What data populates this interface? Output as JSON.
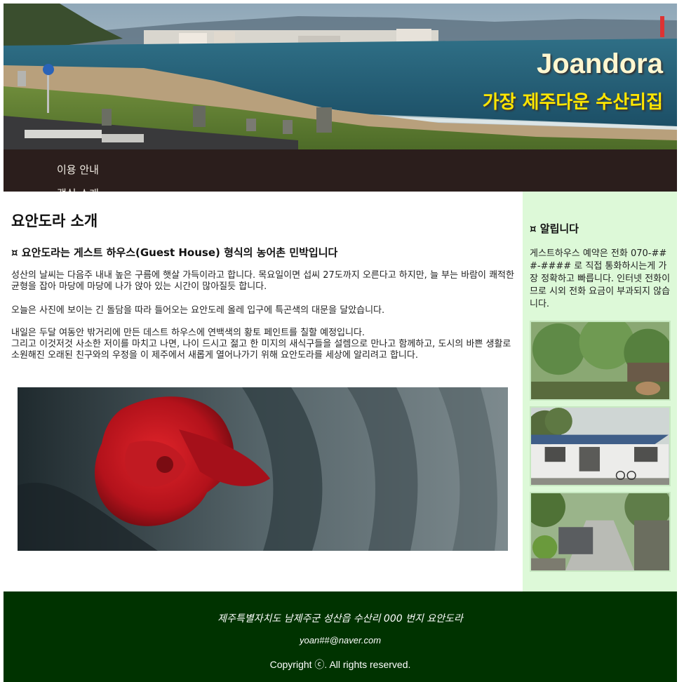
{
  "header": {
    "title": "Joandora",
    "tagline": "가장 제주다운 수산리집"
  },
  "nav": {
    "items": [
      {
        "label": "이용 안내"
      },
      {
        "label": "객실 소개"
      }
    ]
  },
  "main": {
    "title": "요안도라 소개",
    "subtitle": "¤ 요안도라는 게스트 하우스(Guest House) 형식의 농어촌 민박입니다",
    "paragraphs": [
      "성산의 날씨는 다음주 내내 높은 구름에 햇살 가득이라고 합니다. 목요일이면 섭씨 27도까지 오른다고 하지만, 늘 부는 바람이 쾌적한 균형을 잡아 마당에 마당에 나가 앉아 있는 시간이 많아질듯 합니다.",
      "오늘은 사진에 보이는 긴 돌담을 따라 들어오는 요안도레 올레 입구에 특곤색의 대문을 달았습니다.",
      "내일은 두달 여동안 밖거리에 만든 데스트 하우스에 연백색의 황토 페인트를 칠할 예정입니다.",
      "그리고 이것저것 사소한 저이를 마치고 나면, 나이 드시고 젊고 한 미지의 새식구들을 설렘으로 만나고 함께하고, 도시의 바쁜 생활로 소원해진 오래된 친구와의 우정을 이 제주에서 새롭게 열어나가기 위해 요안도라를 세상에 알리려고 합니다."
    ]
  },
  "sidebar": {
    "notice_title": "¤ 알립니다",
    "notice_text": "게스트하우스 예약은 전화 070-###-#### 로 직접 통화하시는게 가장 정확하고 빠릅니다. 인터넷 전화이므로 시외 전화 요금이 부과되지 않습니다."
  },
  "footer": {
    "address": "제주특별자치도 남제주군 성산읍 수산리 000 번지 요안도라",
    "email": "yoan##@naver.com",
    "copyright": "Copyright ⓒ. All rights reserved."
  },
  "colors": {
    "nav_bg": "#2b1e1c",
    "sidebar_bg": "#ddf9d8",
    "footer_bg": "#003300",
    "tagline": "#ffe600"
  }
}
